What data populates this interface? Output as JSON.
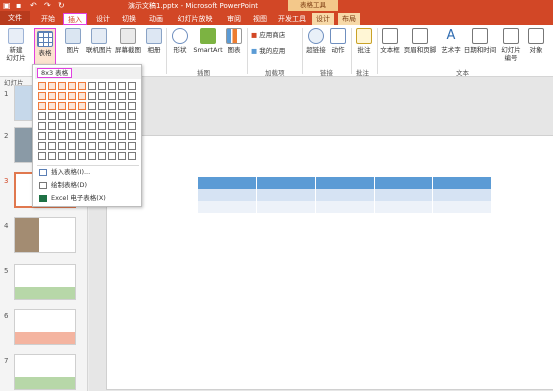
{
  "titlebar": {
    "title": "演示文稿1.pptx - Microsoft PowerPoint",
    "contextual_tools": "表格工具"
  },
  "tabs": [
    {
      "label": "文件"
    },
    {
      "label": "开始"
    },
    {
      "label": "插入"
    },
    {
      "label": "设计"
    },
    {
      "label": "切换"
    },
    {
      "label": "动画"
    },
    {
      "label": "幻灯片放映"
    },
    {
      "label": "审阅"
    },
    {
      "label": "视图"
    },
    {
      "label": "开发工具"
    },
    {
      "label": "设计"
    },
    {
      "label": "布局"
    }
  ],
  "ribbon": {
    "new_slide": "新建\n幻灯片",
    "table": "表格",
    "picture": "图片",
    "online_picture": "联机图片",
    "screenshot": "屏幕截图",
    "album": "相册",
    "shapes": "形状",
    "smartart": "SmartArt",
    "chart": "图表",
    "app_store": "应用商店",
    "my_apps": "我的应用",
    "hyperlink": "超链接",
    "action": "动作",
    "comment": "批注",
    "textbox": "文本框",
    "header_footer": "页眉和页脚",
    "wordart": "艺术字",
    "date_time": "日期和时间",
    "slide_number": "幻灯片\n编号",
    "object": "对象",
    "groups": {
      "illustrations": "插图",
      "addins": "加载项",
      "links": "链接",
      "comments": "批注",
      "text": "文本"
    }
  },
  "panel": {
    "title": "幻灯片",
    "slide_numbers": [
      "1",
      "2",
      "3",
      "4",
      "5",
      "6",
      "7"
    ]
  },
  "dropdown": {
    "size_label": "8x3 表格",
    "grid_cols": 10,
    "grid_rows": 8,
    "highlight_cols": 5,
    "highlight_rows": 3,
    "items": [
      {
        "label": "插入表格(I)...",
        "icon": "insert-table-icon"
      },
      {
        "label": "绘制表格(D)",
        "icon": "draw-table-icon"
      },
      {
        "label": "Excel 电子表格(X)",
        "icon": "excel-icon"
      }
    ]
  },
  "colors": {
    "accent": "#d24726",
    "table_header": "#5b9bd5",
    "table_row1": "#d6e3f3",
    "table_row2": "#edf2f9",
    "highlight": "#e040e0"
  }
}
